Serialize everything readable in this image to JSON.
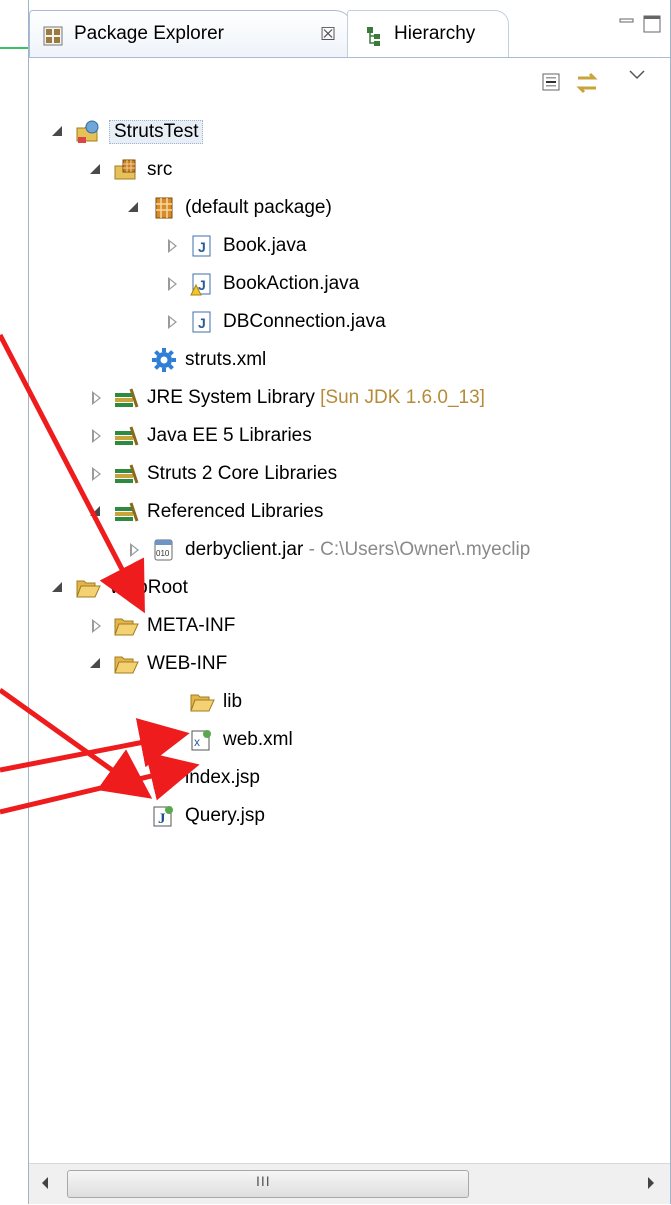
{
  "tabs": [
    {
      "label": "Package Explorer",
      "close": "☒",
      "active": true,
      "icon": "package-explorer-icon"
    },
    {
      "label": "Hierarchy",
      "active": false,
      "icon": "hierarchy-icon"
    }
  ],
  "toolbar": {
    "collapse_icon": "collapse-all-icon",
    "link_icon": "link-with-editor-icon",
    "menu_icon": "view-menu-chevron-icon"
  },
  "tree": {
    "project": "StrutsTest",
    "src": "src",
    "default_package": "(default package)",
    "book": "Book.java",
    "book_action": "BookAction.java",
    "db_connection": "DBConnection.java",
    "struts_xml": "struts.xml",
    "jre": "JRE System Library",
    "jre_decoration": "[Sun JDK 1.6.0_13]",
    "javaee": "Java EE 5 Libraries",
    "struts_core": "Struts 2 Core Libraries",
    "referenced": "Referenced Libraries",
    "derby": "derbyclient.jar",
    "derby_decoration": "- C:\\Users\\Owner\\.myeclip",
    "webroot": "WebRoot",
    "meta_inf": "META-INF",
    "web_inf": "WEB-INF",
    "lib": "lib",
    "web_xml": "web.xml",
    "index_jsp": "index.jsp",
    "query_jsp": "Query.jsp"
  },
  "scrollbar": {
    "thumb_grip": "III"
  },
  "colors": {
    "annotation_arrow": "#ee1c1c",
    "decoration": "#b58b3a",
    "panel_border": "#9fb4cb"
  }
}
